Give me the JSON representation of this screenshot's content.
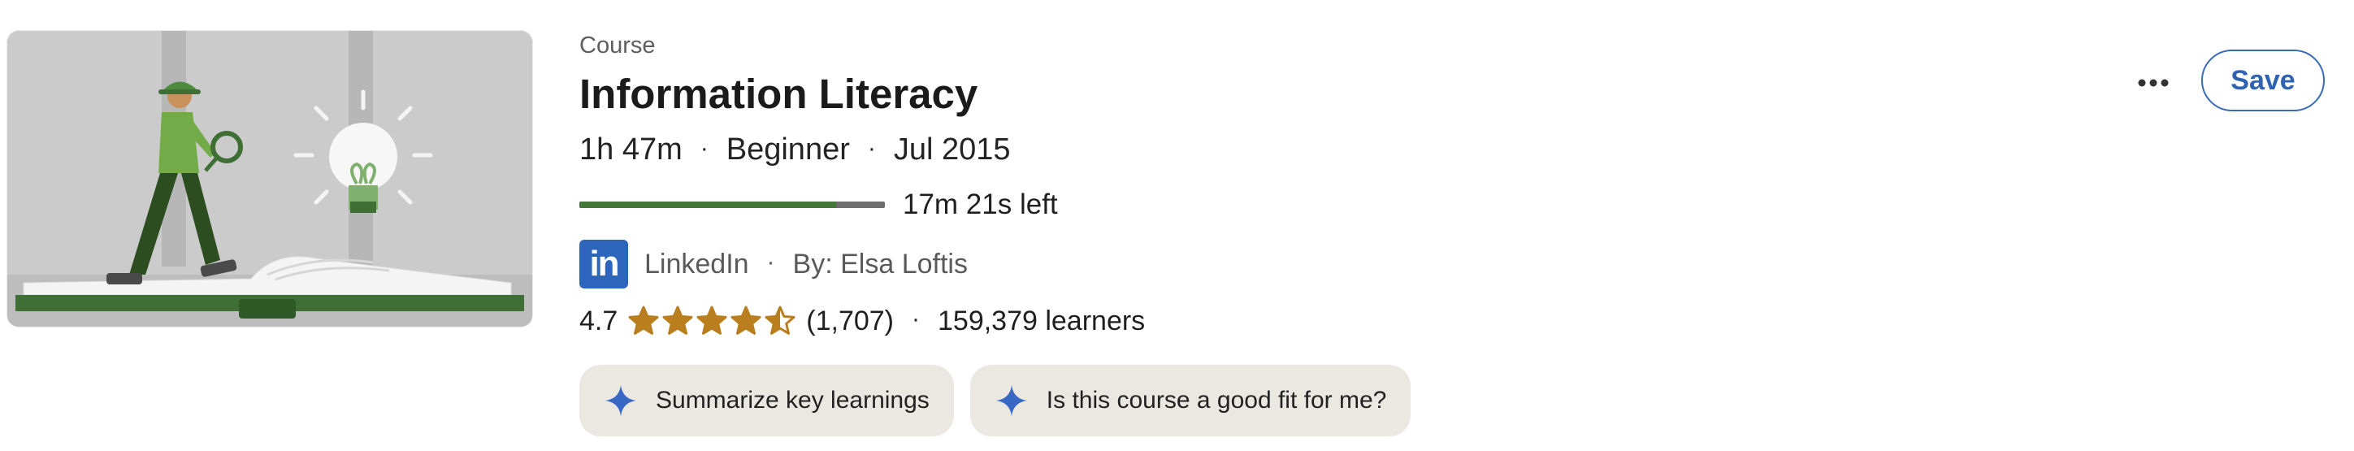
{
  "course": {
    "type_label": "Course",
    "title": "Information Literacy",
    "duration": "1h 47m",
    "level": "Beginner",
    "date": "Jul 2015",
    "meta_separator": "·",
    "progress_fraction": 0.84,
    "progress_text": "17m 21s left",
    "provider_logo_text": "in",
    "provider": "LinkedIn",
    "author": "By: Elsa Loftis",
    "rating": "4.7",
    "rating_stars_value": 4.7,
    "rating_count": "(1,707)",
    "learners": "159,379 learners"
  },
  "chips": [
    {
      "label": "Summarize key learnings",
      "icon": "sparkle-icon"
    },
    {
      "label": "Is this course a good fit for me?",
      "icon": "sparkle-icon"
    }
  ],
  "actions": {
    "more_icon": "more-options-icon",
    "save_label": "Save"
  },
  "colors": {
    "progress_fill": "#44773a",
    "progress_track": "#6e6e6e",
    "star": "#b97f1e",
    "linkedin_blue": "#2d64bc",
    "save_border": "#3a6bb7",
    "chip_bg": "#ebe8e2",
    "sparkle": "#3867c4"
  }
}
